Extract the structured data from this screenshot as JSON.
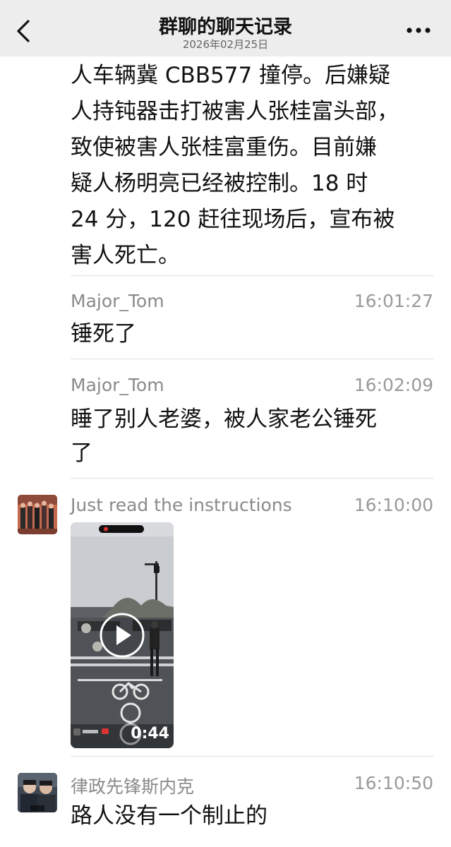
{
  "header": {
    "title": "群聊的聊天记录",
    "subtitle": "2026年02月25日"
  },
  "first_message": {
    "lines": [
      "人车辆冀 CBB577 撞停。后嫌疑",
      "人持钝器击打被害人张桂富头部，",
      "致使被害人张桂富重伤。目前嫌",
      "疑人杨明亮已经被控制。18 时",
      "24 分，120 赶往现场后，宣布被",
      "害人死亡。"
    ]
  },
  "messages": [
    {
      "sender": "Major_Tom",
      "time": "16:01:27",
      "lines": [
        "锤死了"
      ]
    },
    {
      "sender": "Major_Tom",
      "time": "16:02:09",
      "lines": [
        "睡了别人老婆，被人家老公锤死",
        "了"
      ]
    },
    {
      "sender": "Just read the instructions",
      "time": "16:10:00",
      "video_duration": "0:44"
    },
    {
      "sender": "律政先锋斯内克",
      "time": "16:10:50",
      "lines": [
        "路人没有一个制止的"
      ]
    }
  ],
  "icons": [
    "back-chevron-icon",
    "more-dots-icon",
    "play-icon"
  ],
  "colors": {
    "nav_bg": "#ededed",
    "text": "#111111",
    "meta": "#8a8a8a"
  }
}
